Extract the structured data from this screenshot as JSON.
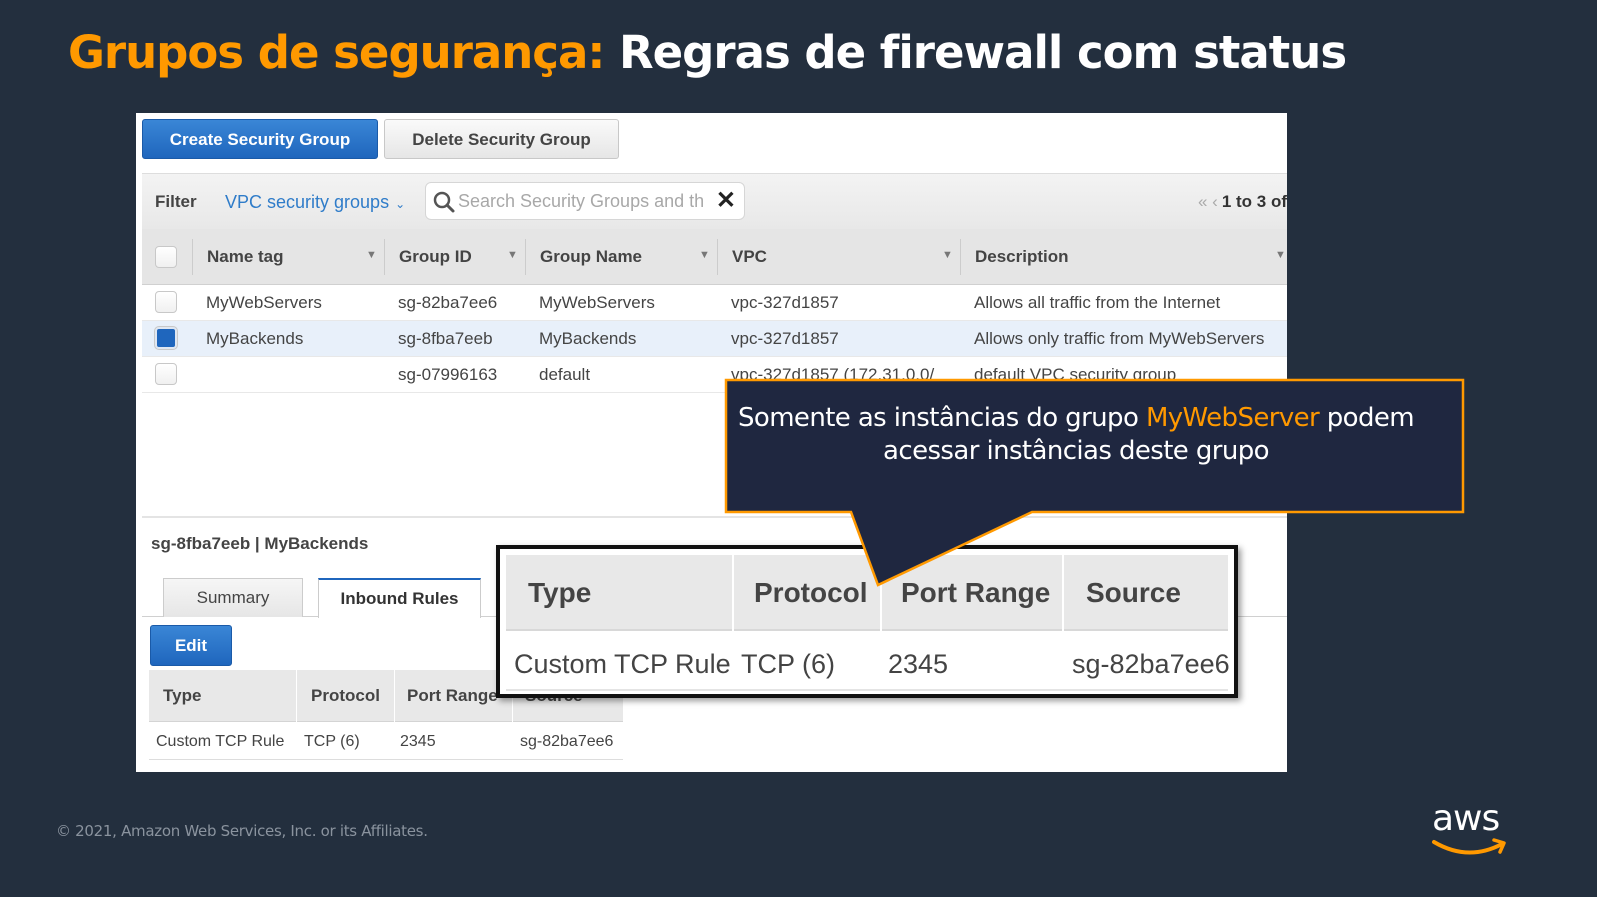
{
  "slide": {
    "title_accent": "Grupos de segurança:",
    "title_rest": "Regras de firewall com status",
    "footer": "© 2021, Amazon Web Services, Inc. or its Affiliates.",
    "logo_text": "aws",
    "colors": {
      "background": "#232f3e",
      "accent": "#ff9900",
      "callout_bg": "#1f2740"
    }
  },
  "console": {
    "toolbar": {
      "create_label": "Create Security Group",
      "delete_label": "Delete Security Group"
    },
    "filter": {
      "label": "Filter",
      "selected": "VPC security groups",
      "search_placeholder": "Search Security Groups and th",
      "pager_text": "1 to 3 of"
    },
    "grid": {
      "columns": [
        "Name tag",
        "Group ID",
        "Group Name",
        "VPC",
        "Description"
      ],
      "rows": [
        {
          "name_tag": "MyWebServers",
          "group_id": "sg-82ba7ee6",
          "group_name": "MyWebServers",
          "vpc": "vpc-327d1857",
          "description": "Allows all traffic from the Internet",
          "selected": false
        },
        {
          "name_tag": "MyBackends",
          "group_id": "sg-8fba7eeb",
          "group_name": "MyBackends",
          "vpc": "vpc-327d1857",
          "description": "Allows only traffic from MyWebServers",
          "selected": true
        },
        {
          "name_tag": "",
          "group_id": "sg-07996163",
          "group_name": "default",
          "vpc": "vpc-327d1857 (172.31.0.0/",
          "description": "default VPC security group",
          "selected": false
        }
      ]
    },
    "detail": {
      "title": "sg-8fba7eeb | MyBackends",
      "tabs": [
        "Summary",
        "Inbound Rules"
      ],
      "active_tab": "Inbound Rules",
      "edit_label": "Edit",
      "rules_columns": [
        "Type",
        "Protocol",
        "Port Range",
        "Source"
      ],
      "rules": [
        {
          "type": "Custom TCP Rule",
          "protocol": "TCP (6)",
          "port_range": "2345",
          "source": "sg-82ba7ee6"
        }
      ]
    }
  },
  "callout": {
    "text_before": "Somente as instâncias do grupo ",
    "highlight": "MyWebServer",
    "text_after": " podem acessar instâncias deste grupo"
  }
}
